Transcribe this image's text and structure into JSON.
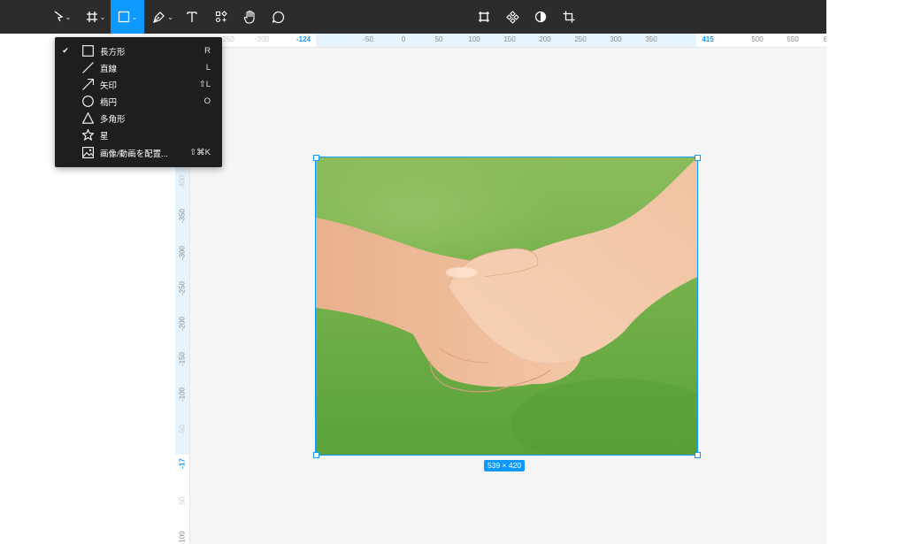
{
  "toolbar": {
    "left_tools": [
      {
        "name": "move-tool",
        "icon": "cursor-icon",
        "has_menu": true
      },
      {
        "name": "frame-tool",
        "icon": "hash-frame-icon",
        "has_menu": true
      },
      {
        "name": "shape-tool",
        "icon": "rectangle-icon",
        "has_menu": true,
        "active": true
      },
      {
        "name": "pen-tool",
        "icon": "pen-icon",
        "has_menu": true
      },
      {
        "name": "text-tool",
        "icon": "text-icon"
      },
      {
        "name": "resources-tool",
        "icon": "resources-icon"
      },
      {
        "name": "hand-tool",
        "icon": "hand-icon"
      },
      {
        "name": "comment-tool",
        "icon": "comment-icon"
      }
    ],
    "center_tools": [
      {
        "name": "frame-selection",
        "icon": "frame-selection-icon"
      },
      {
        "name": "create-component",
        "icon": "component-icon"
      },
      {
        "name": "mask",
        "icon": "mask-icon"
      },
      {
        "name": "crop",
        "icon": "crop-icon"
      }
    ]
  },
  "shape_menu": {
    "items": [
      {
        "label": "長方形",
        "shortcut": "R",
        "icon": "rectangle-icon",
        "checked": true
      },
      {
        "label": "直線",
        "shortcut": "L",
        "icon": "line-icon",
        "checked": false
      },
      {
        "label": "矢印",
        "shortcut": "⇧L",
        "icon": "arrow-icon",
        "checked": false
      },
      {
        "label": "楕円",
        "shortcut": "O",
        "icon": "ellipse-icon",
        "checked": false
      },
      {
        "label": "多角形",
        "shortcut": "",
        "icon": "polygon-icon",
        "checked": false
      },
      {
        "label": "星",
        "shortcut": "",
        "icon": "star-icon",
        "checked": false
      },
      {
        "label": "画像/動画を配置...",
        "shortcut": "⇧⌘K",
        "icon": "image-icon",
        "checked": false
      }
    ],
    "checkmark": "✔"
  },
  "ruler_top": {
    "labels": [
      "250",
      "-200",
      "-124",
      "-50",
      "0",
      "50",
      "100",
      "150",
      "200",
      "250",
      "300",
      "350",
      "415",
      "500",
      "550",
      "6"
    ],
    "selection_start": "-124",
    "selection_end": "415"
  },
  "ruler_left": {
    "labels": [
      "-400",
      "-350",
      "-300",
      "-250",
      "-200",
      "-150",
      "-100",
      "-50",
      "-17",
      "50",
      "100"
    ],
    "selection_end": "-17"
  },
  "selection": {
    "size_label": "539 × 420",
    "width": 539,
    "height": 420
  },
  "colors": {
    "toolbar": "#2c2c2c",
    "accent": "#0d99ff",
    "canvas": "#f5f5f5",
    "menu": "#1e1e1e"
  }
}
